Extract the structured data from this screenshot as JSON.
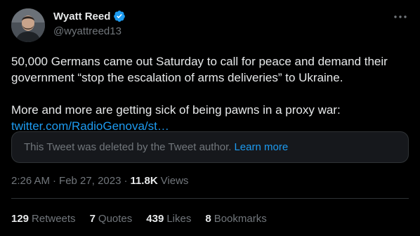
{
  "author": {
    "display_name": "Wyatt Reed",
    "handle": "@wyattreed13",
    "verified": true,
    "verified_color": "#1d9bf0"
  },
  "tweet": {
    "line1": "50,000 Germans came out Saturday to call for peace and demand their government “stop the escalation of arms deliveries” to Ukraine.",
    "line2": "More and more are getting sick of being pawns in a proxy war:",
    "link": "twitter.com/RadioGenova/st…",
    "deleted_notice": "This Tweet was deleted by the Tweet author.",
    "deleted_learn_more": "Learn more",
    "time": "2:26 AM",
    "separator": "·",
    "date": "Feb 27, 2023",
    "views_count": "11.8K",
    "views_label": "Views"
  },
  "stats": [
    {
      "num": "129",
      "label": "Retweets"
    },
    {
      "num": "7",
      "label": "Quotes"
    },
    {
      "num": "439",
      "label": "Likes"
    },
    {
      "num": "8",
      "label": "Bookmarks"
    }
  ],
  "icons": {
    "more": "more-dots-icon",
    "verified": "verified-badge-icon"
  },
  "colors": {
    "background": "#000000",
    "text": "#e7e9ea",
    "secondary": "#71767b",
    "accent": "#1d9bf0"
  }
}
